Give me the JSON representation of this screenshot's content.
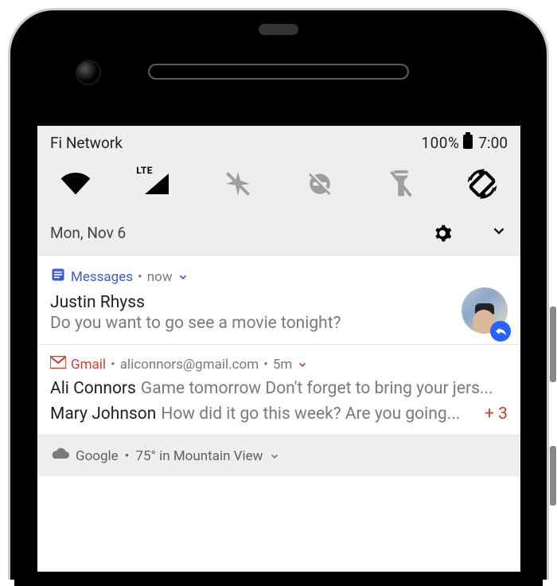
{
  "status": {
    "carrier": "Fi Network",
    "battery_pct": "100%",
    "time": "7:00",
    "date": "Mon, Nov 6"
  },
  "qs": {
    "wifi": "wifi-icon",
    "lte": "LTE",
    "airplane": "airplane-off-icon",
    "dnd": "dnd-off-icon",
    "flash": "flashlight-off-icon",
    "rotate": "auto-rotate-icon"
  },
  "notifications": {
    "messages": {
      "app": "Messages",
      "when": "now",
      "sep": " • ",
      "title": "Justin Rhyss",
      "body": "Do you want to go see a movie tonight?"
    },
    "gmail": {
      "app": "Gmail",
      "account": "aliconnors@gmail.com",
      "when": "5m",
      "sep": " • ",
      "rows": [
        {
          "from": "Ali Connors",
          "snippet": "Game tomorrow Don't forget to bring your jers..."
        },
        {
          "from": "Mary Johnson",
          "snippet": "How did it go this week? Are you going..."
        }
      ],
      "overflow": "+ 3"
    },
    "weather": {
      "app": "Google",
      "summary": "75° in Mountain View",
      "sep": " • "
    }
  }
}
